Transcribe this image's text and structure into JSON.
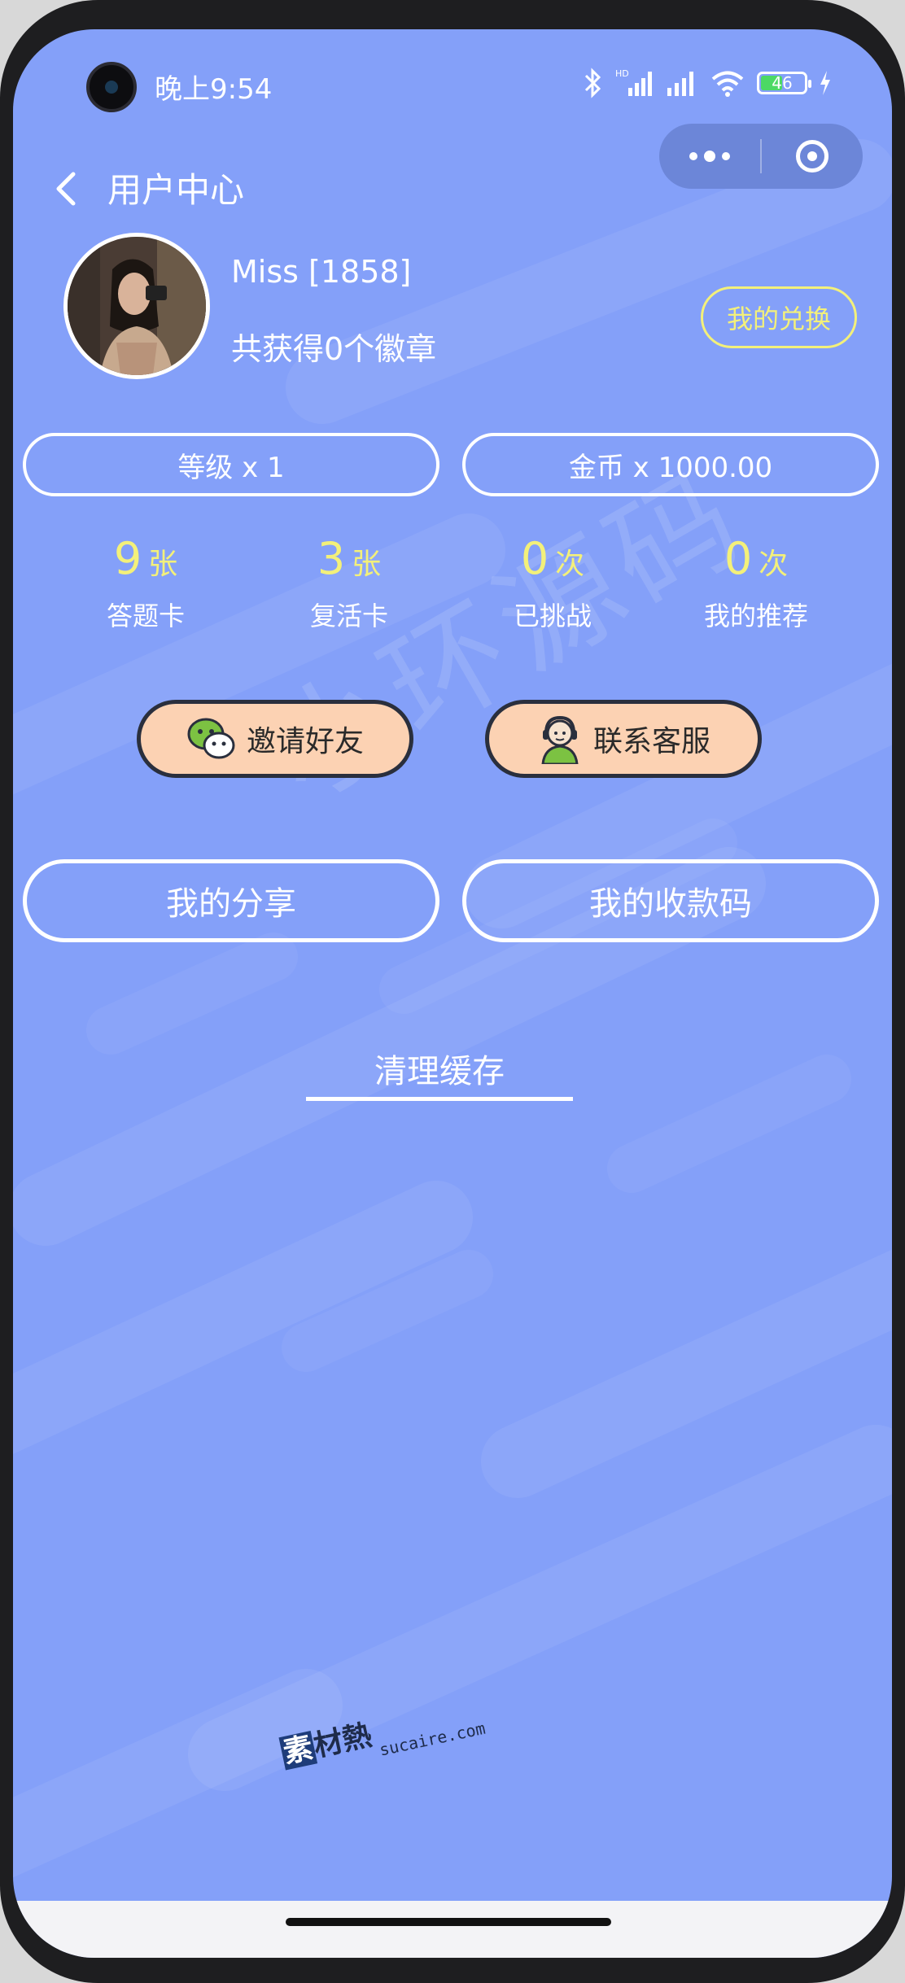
{
  "status_bar": {
    "time": "晚上9:54",
    "network": "HD",
    "battery_level": "46",
    "icons": [
      "bluetooth-icon",
      "signal-icon",
      "wifi-icon",
      "battery-icon",
      "charging-icon"
    ]
  },
  "nav": {
    "title": "用户中心",
    "back_icon": "chevron-left-icon",
    "capsule": {
      "more_icon": "more-dots-icon",
      "close_icon": "target-icon"
    }
  },
  "profile": {
    "username": "Miss [1858]",
    "badges_text": "共获得0个徽章",
    "exchange_label": "我的兑换"
  },
  "summary": {
    "level_label": "等级 x 1",
    "coins_label": "金币 x 1000.00"
  },
  "stats": [
    {
      "value": "9",
      "unit": "张",
      "label": "答题卡"
    },
    {
      "value": "3",
      "unit": "张",
      "label": "复活卡"
    },
    {
      "value": "0",
      "unit": "次",
      "label": "已挑战"
    },
    {
      "value": "0",
      "unit": "次",
      "label": "我的推荐"
    }
  ],
  "actions": {
    "invite_label": "邀请好友",
    "service_label": "联系客服"
  },
  "links": {
    "share_label": "我的分享",
    "qr_label": "我的收款码",
    "clear_cache_label": "清理缓存"
  },
  "watermark": "小环源码",
  "brand": {
    "name_first": "素",
    "name_rest": "材熱",
    "url": "sucaire.com"
  },
  "colors": {
    "background": "#84a0f9",
    "accent_yellow": "#f3f07a",
    "button_peach": "#fcd2b3",
    "text_white": "#ffffff"
  }
}
